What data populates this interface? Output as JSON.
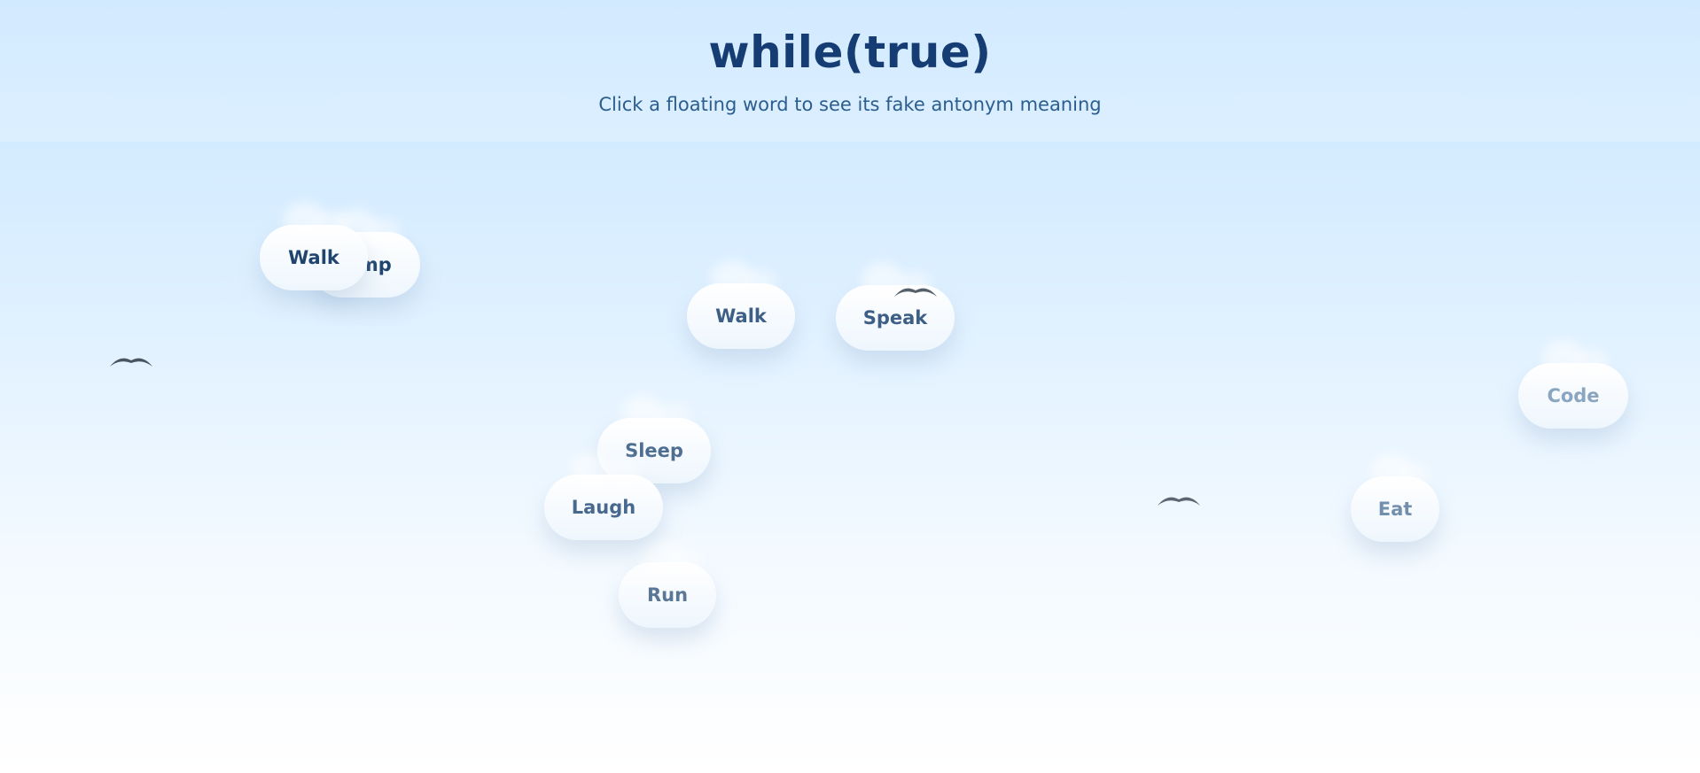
{
  "header": {
    "title": "while(true)",
    "subtitle": "Click a floating word to see its fake antonym meaning"
  },
  "words": [
    {
      "id": "jump",
      "label": "Jump"
    },
    {
      "id": "walk-1",
      "label": "Walk"
    },
    {
      "id": "walk-2",
      "label": "Walk"
    },
    {
      "id": "speak",
      "label": "Speak"
    },
    {
      "id": "code",
      "label": "Code"
    },
    {
      "id": "sleep",
      "label": "Sleep"
    },
    {
      "id": "laugh",
      "label": "Laugh"
    },
    {
      "id": "run",
      "label": "Run"
    },
    {
      "id": "eat",
      "label": "Eat"
    }
  ],
  "birds": [
    "bird-icon",
    "bird-icon",
    "bird-icon"
  ],
  "colors": {
    "title": "#163d73",
    "subtitle": "#2b5d8f",
    "word_dark": "#1f446e",
    "word_mid": "#3f6488",
    "word_light": "#8aa5bf"
  }
}
